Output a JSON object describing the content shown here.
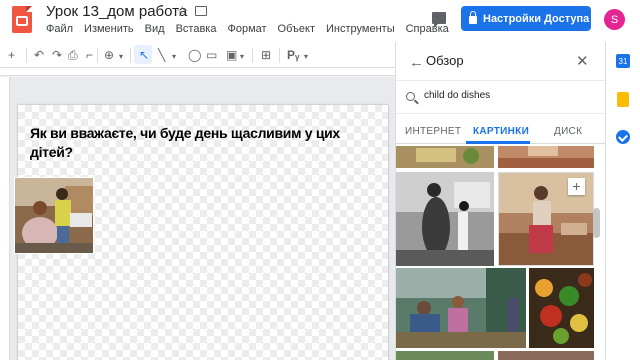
{
  "document": {
    "title": "Урок 13_дом работа",
    "menu": [
      "Файл",
      "Изменить",
      "Вид",
      "Вставка",
      "Формат",
      "Объект",
      "Инструменты",
      "Справка"
    ]
  },
  "header": {
    "share_label": "Настройки Доступа",
    "avatar_letter": "S"
  },
  "slide": {
    "question": "Як ви вважаєте, чи буде день щасливим у цих дітей?"
  },
  "explore": {
    "title": "Обзор",
    "search_value": "child do dishes",
    "tabs": [
      "ИНТЕРНЕТ",
      "КАРТИНКИ",
      "ДИСК"
    ],
    "active_tab": "КАРТИНКИ",
    "add_icon_glyph": "+"
  },
  "rail": {
    "calendar_day": "31"
  },
  "colors": {
    "accent": "#1a73e8",
    "slides_brand": "#f1543f",
    "avatar": "#e52592"
  }
}
